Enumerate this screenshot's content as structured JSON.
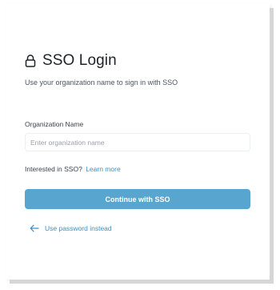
{
  "login": {
    "title": "SSO Login",
    "subtitle": "Use your organization name to sign in with SSO",
    "icon": "lock-icon",
    "org_field": {
      "label": "Organization Name",
      "value": "",
      "placeholder": "Enter organization name"
    },
    "interest_text": "Interested in SSO?",
    "learn_more": "Learn more",
    "submit_label": "Continue with SSO",
    "back_label": "Use password instead",
    "back_icon": "arrow-left-icon"
  },
  "colors": {
    "accent": "#58a6cf",
    "link": "#3a90c7",
    "text": "#1f2328",
    "muted": "#4d5562"
  }
}
